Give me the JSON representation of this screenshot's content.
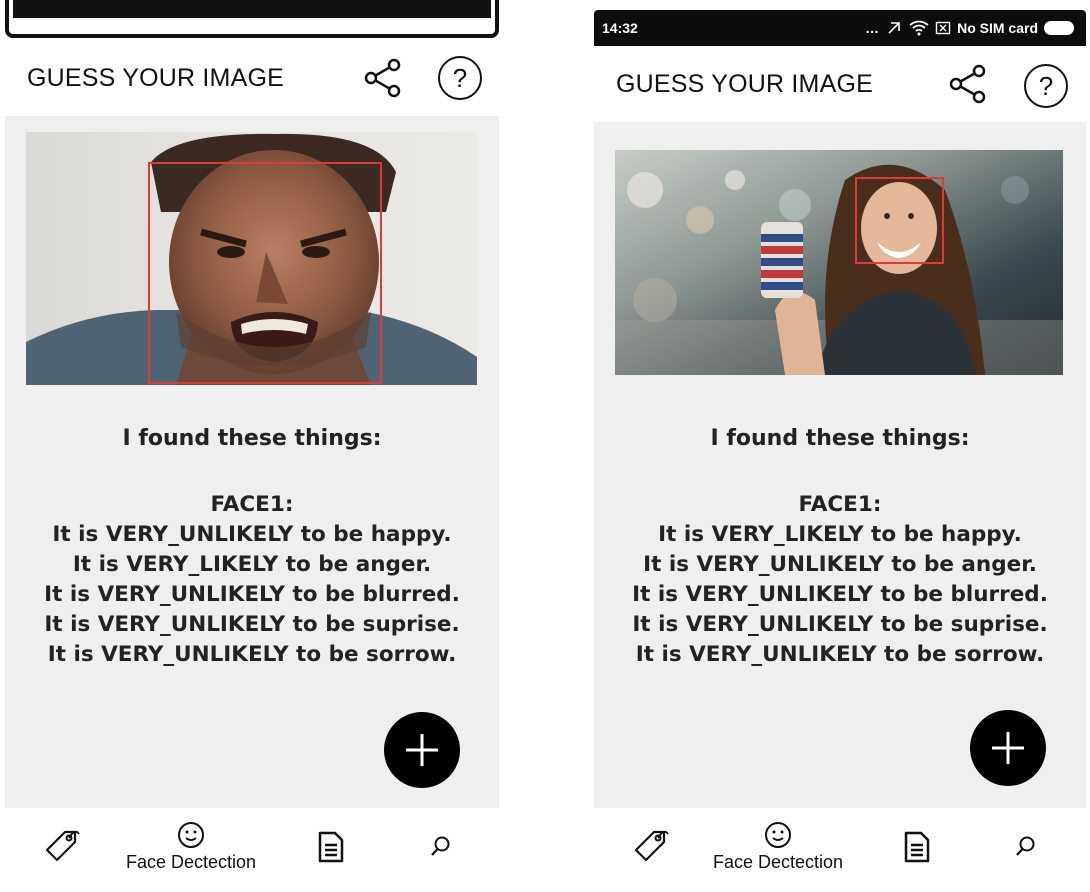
{
  "screens": [
    {
      "status": {
        "time": "",
        "carrier": ""
      },
      "appbar": {
        "title": "GUESS YOUR IMAGE",
        "share_icon": "share-icon",
        "help_icon": "help-icon"
      },
      "result": {
        "heading": "I found these things:",
        "lines": [
          "FACE1:",
          "It is VERY_UNLIKELY to be happy.",
          "It is VERY_LIKELY to be anger.",
          "It is VERY_UNLIKELY to be blurred.",
          "It is VERY_UNLIKELY to be suprise.",
          "It is VERY_UNLIKELY to be sorrow."
        ]
      },
      "fab_icon": "plus-icon",
      "bottom_nav": {
        "tags_icon": "tag-icon",
        "face_label": "Face Dectection",
        "document_icon": "document-icon",
        "search_icon": "search-icon"
      }
    },
    {
      "status": {
        "time": "14:32",
        "carrier": "No SIM card"
      },
      "appbar": {
        "title": "GUESS YOUR IMAGE",
        "share_icon": "share-icon",
        "help_icon": "help-icon"
      },
      "result": {
        "heading": "I found these things:",
        "lines": [
          "FACE1:",
          "It is VERY_LIKELY to be happy.",
          "It is VERY_UNLIKELY to be anger.",
          "It is VERY_UNLIKELY to be blurred.",
          "It is VERY_UNLIKELY to be suprise.",
          "It is VERY_UNLIKELY to be sorrow."
        ]
      },
      "fab_icon": "plus-icon",
      "bottom_nav": {
        "tags_icon": "tag-icon",
        "face_label": "Face Dectection",
        "document_icon": "document-icon",
        "search_icon": "search-icon"
      }
    }
  ],
  "colors": {
    "accent": "#000000",
    "face_box": "#e0393a",
    "content_bg": "#efefef"
  }
}
